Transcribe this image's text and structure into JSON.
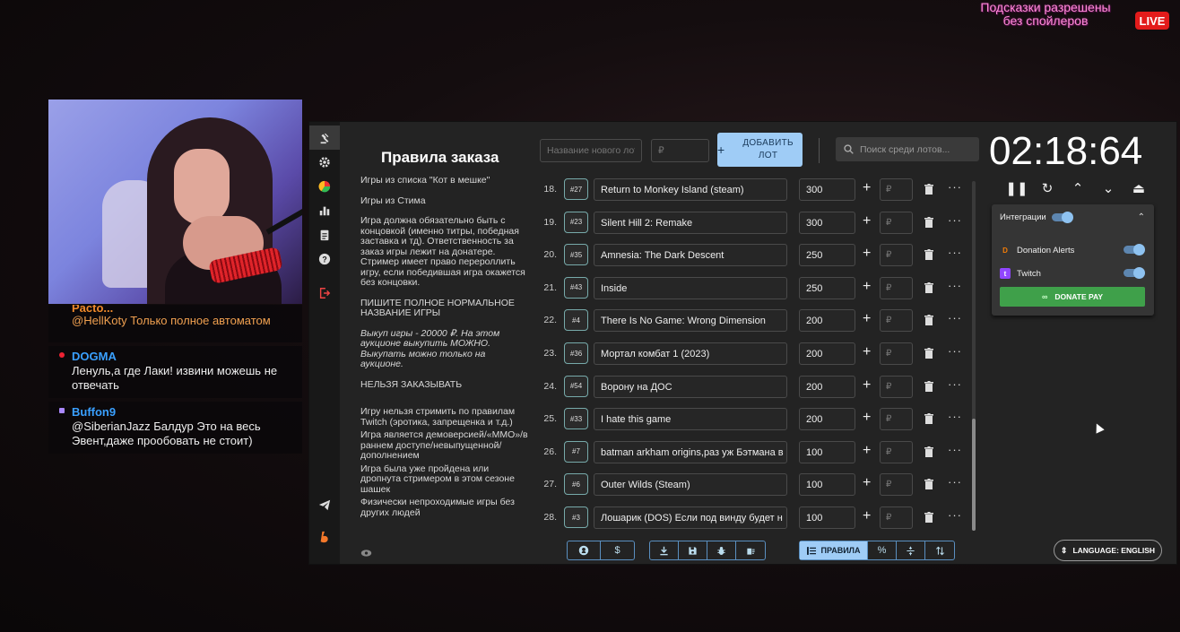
{
  "overlay": {
    "hint_line1": "Подсказки разрешены",
    "hint_line2": "без спойлеров",
    "live": "LIVE"
  },
  "chat": [
    {
      "user": "Pacto...",
      "text": "@HellKoty Только полное автоматом",
      "color": "#f08a2a",
      "partial": true
    },
    {
      "user": "DOGMA",
      "text": "Ленуль,а где Лаки! извини можешь не отвечать",
      "color": "#3aa0ff",
      "badge": "#e23"
    },
    {
      "user": "Buffon9",
      "text": "@SiberianJazz Балдур Это на весь Эвент,даже прообовать не стоит)",
      "color": "#3aa0ff",
      "badge": "#a8f"
    }
  ],
  "rules": {
    "title": "Правила заказа",
    "paragraphs": [
      {
        "text": "Игры из списка \"Кот в мешке\"",
        "style": ""
      },
      {
        "text": "Игры из Стима",
        "style": ""
      },
      {
        "text": "Игра должна обязательно быть с концовкой (именно титры, победная заставка и тд). Ответственность за заказ игры лежит на донатере. Стример имеет право перероллить игру, если победившая игра окажется без концовки.",
        "style": ""
      },
      {
        "text": "ПИШИТЕ ПОЛНОЕ НОРМАЛЬНОЕ НАЗВАНИЕ ИГРЫ",
        "style": "tight"
      },
      {
        "text": "Выкуп игры - 20000 ₽. На этом аукционе выкупить МОЖНО. Выкупать можно только на аукционе.",
        "style": "it"
      },
      {
        "text": "НЕЛЬЗЯ ЗАКАЗЫВАТЬ",
        "style": ""
      },
      {
        "text": "Игру нельзя стримить по правилам Twitch (эротика, запрещенка и т.д.)",
        "style": "tight"
      },
      {
        "text": "Игра является демоверсией/«ММО»/в раннем доступе/невыпущенной/дополнением",
        "style": "tight"
      },
      {
        "text": "Игра была уже пройдена или дропнута стримером в этом сезоне шашек",
        "style": "tight"
      },
      {
        "text": "Физически непроходимые игры без других людей",
        "style": "tight"
      }
    ]
  },
  "top": {
    "new_lot_placeholder": "Название нового лот",
    "amount_placeholder": "₽",
    "add_plus": "+",
    "add_label": "ДОБАВИТЬ ЛОТ",
    "search_placeholder": "Поиск среди лотов..."
  },
  "lots": [
    {
      "num": "18.",
      "id": "#27",
      "name": "Return to Monkey Island (steam)",
      "amount": "300"
    },
    {
      "num": "19.",
      "id": "#23",
      "name": "Silent Hill 2: Remake",
      "amount": "300"
    },
    {
      "num": "20.",
      "id": "#35",
      "name": "Amnesia: The Dark Descent",
      "amount": "250"
    },
    {
      "num": "21.",
      "id": "#43",
      "name": "Inside",
      "amount": "250"
    },
    {
      "num": "22.",
      "id": "#4",
      "name": "There Is No Game: Wrong Dimension",
      "amount": "200"
    },
    {
      "num": "23.",
      "id": "#36",
      "name": "Мортал комбат 1  (2023)",
      "amount": "200"
    },
    {
      "num": "24.",
      "id": "#54",
      "name": "Ворону на ДОС",
      "amount": "200"
    },
    {
      "num": "25.",
      "id": "#33",
      "name": "I hate this game",
      "amount": "200"
    },
    {
      "num": "26.",
      "id": "#7",
      "name": "batman arkham origins,раз уж Бэтмана в",
      "amount": "100"
    },
    {
      "num": "27.",
      "id": "#6",
      "name": "Outer Wilds (Steam)",
      "amount": "100"
    },
    {
      "num": "28.",
      "id": "#3",
      "name": "Лошарик (DOS) Если под винду будет н",
      "amount": "100"
    }
  ],
  "lot_rub": "₽",
  "lot_plus": "+",
  "lot_more": "···",
  "timer": "02:18:64",
  "integrations": {
    "title": "Интеграции",
    "items": [
      {
        "name": "Donation Alerts",
        "icon_letter": "D",
        "icon_color": "#f57d07"
      },
      {
        "name": "Twitch",
        "icon_letter": "t",
        "icon_color": "#9146ff"
      }
    ],
    "donate_label": "DONATE PAY"
  },
  "bottom": {
    "rules_label": "ПРАВИЛА",
    "dollar": "$",
    "percent": "%",
    "language": "LANGUAGE: ENGLISH"
  }
}
